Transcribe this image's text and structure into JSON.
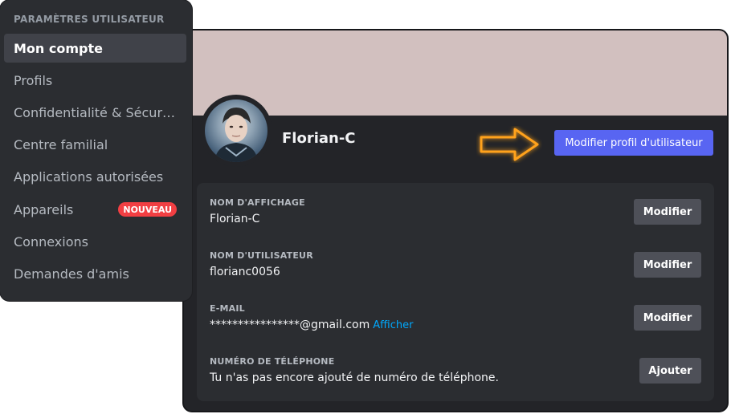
{
  "sidebar": {
    "header": "PARAMÈTRES UTILISATEUR",
    "items": [
      {
        "label": "Mon compte",
        "active": true
      },
      {
        "label": "Profils"
      },
      {
        "label": "Confidentialité & Sécurité"
      },
      {
        "label": "Centre familial"
      },
      {
        "label": "Applications autorisées"
      },
      {
        "label": "Appareils",
        "badge": "NOUVEAU"
      },
      {
        "label": "Connexions"
      },
      {
        "label": "Demandes d'amis"
      }
    ]
  },
  "account": {
    "username": "Florian-C",
    "edit_profile_button": "Modifier profil d'utilisateur",
    "banner_color": "#d2c0bf",
    "avatar_icon": "user-avatar-photo",
    "highlight_icon": "arrow-right-icon",
    "fields": [
      {
        "label": "NOM D'AFFICHAGE",
        "value": "Florian-C",
        "button": "Modifier"
      },
      {
        "label": "NOM D'UTILISATEUR",
        "value": "florianc0056",
        "button": "Modifier"
      },
      {
        "label": "E-MAIL",
        "value": "****************@gmail.com",
        "link": "Afficher",
        "button": "Modifier"
      },
      {
        "label": "NUMÉRO DE TÉLÉPHONE",
        "value": "Tu n'as pas encore ajouté de numéro de téléphone.",
        "button": "Ajouter"
      }
    ]
  },
  "colors": {
    "accent": "#5865f2",
    "badge": "#f23f43",
    "link": "#00a8fc",
    "highlight_arrow": "#ffa21a"
  }
}
